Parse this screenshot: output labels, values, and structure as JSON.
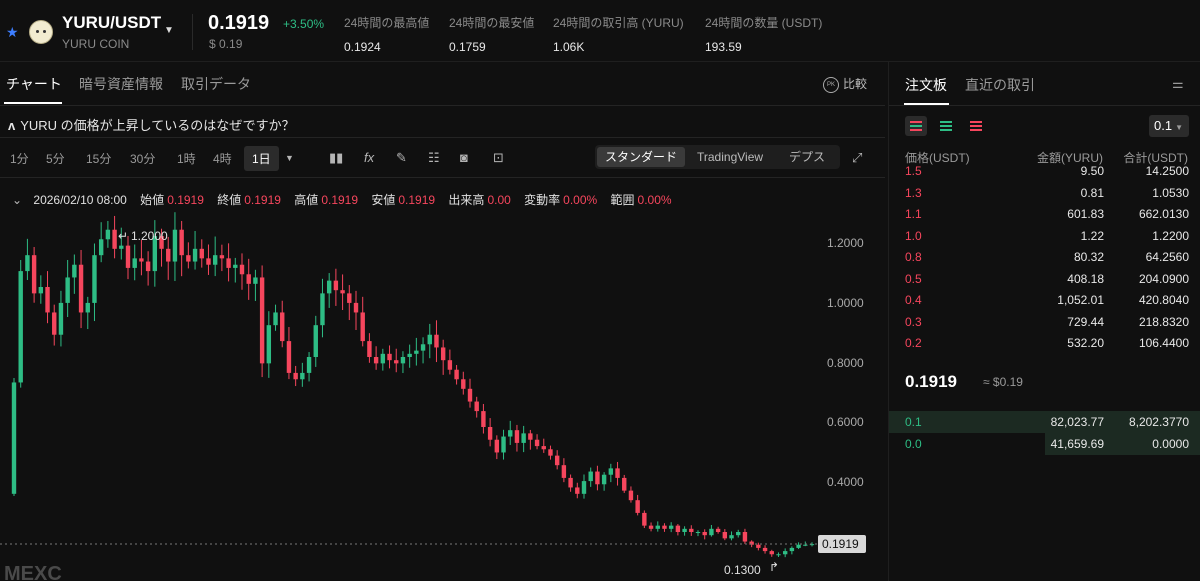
{
  "header": {
    "pair": "YURU/USDT",
    "coin_name": "YURU COIN",
    "price": "0.1919",
    "change": "+3.50%",
    "price_usd": "$ 0.19",
    "stats": [
      {
        "label": "24時間の最高値",
        "value": "0.1924"
      },
      {
        "label": "24時間の最安値",
        "value": "0.1759"
      },
      {
        "label": "24時間の取引高 (YURU)",
        "value": "1.06K"
      },
      {
        "label": "24時間の数量 (USDT)",
        "value": "193.59"
      }
    ]
  },
  "left_tabs": [
    "チャート",
    "暗号資産情報",
    "取引データ"
  ],
  "compare_label": "比較",
  "compare_icon": "PK",
  "why_text": "YURU の価格が上昇しているのはなぜですか？",
  "intervals": [
    "1分",
    "5分",
    "15分",
    "30分",
    "1時",
    "4時",
    "1日"
  ],
  "selected_interval": "1日",
  "view_modes": [
    "スタンダード",
    "TradingView",
    "デプス"
  ],
  "ohlc": {
    "date": "2026/02/10 08:00",
    "open_label": "始値",
    "open": "0.1919",
    "close_label": "終値",
    "close": "0.1919",
    "high_label": "高値",
    "high": "0.1919",
    "low_label": "安値",
    "low": "0.1919",
    "volume_label": "出来高",
    "volume": "0.00",
    "change_label": "変動率",
    "change": "0.00%",
    "range_label": "範囲",
    "range": "0.00%"
  },
  "chart_data": {
    "type": "candlestick",
    "y_ticks": [
      1.2,
      1.0,
      0.8,
      0.6,
      0.4
    ],
    "y_tick_labels": [
      "1.2000",
      "1.0000",
      "0.8000",
      "0.6000",
      "0.4000"
    ],
    "ylim": [
      0.12,
      1.33
    ],
    "high_marker": "1.2000",
    "low_marker": "0.1300",
    "last_price": "0.1919",
    "watermark": "MEXC",
    "colors": {
      "up": "#2ebd85",
      "down": "#f6465d"
    },
    "closes": [
      0.7,
      1.05,
      1.1,
      0.98,
      1.0,
      0.92,
      0.85,
      0.95,
      1.03,
      1.07,
      0.92,
      0.95,
      1.1,
      1.15,
      1.18,
      1.12,
      1.13,
      1.06,
      1.09,
      1.08,
      1.05,
      1.16,
      1.12,
      1.08,
      1.18,
      1.1,
      1.08,
      1.12,
      1.09,
      1.07,
      1.1,
      1.09,
      1.06,
      1.07,
      1.04,
      1.01,
      1.03,
      0.76,
      0.88,
      0.92,
      0.83,
      0.73,
      0.71,
      0.73,
      0.78,
      0.88,
      0.98,
      1.02,
      0.99,
      0.98,
      0.95,
      0.92,
      0.83,
      0.78,
      0.76,
      0.79,
      0.77,
      0.76,
      0.78,
      0.79,
      0.8,
      0.82,
      0.85,
      0.81,
      0.77,
      0.74,
      0.71,
      0.68,
      0.64,
      0.61,
      0.56,
      0.52,
      0.48,
      0.53,
      0.55,
      0.51,
      0.54,
      0.52,
      0.5,
      0.49,
      0.47,
      0.44,
      0.4,
      0.37,
      0.35,
      0.39,
      0.42,
      0.38,
      0.41,
      0.43,
      0.4,
      0.36,
      0.33,
      0.29,
      0.25,
      0.24,
      0.25,
      0.24,
      0.25,
      0.23,
      0.24,
      0.23,
      0.23,
      0.22,
      0.24,
      0.23,
      0.21,
      0.22,
      0.23,
      0.2,
      0.19,
      0.18,
      0.17,
      0.16,
      0.16,
      0.17,
      0.18,
      0.19,
      0.19,
      0.1919
    ]
  },
  "right_tabs": [
    "注文板",
    "直近の取引"
  ],
  "precision": "0.1",
  "orderbook_headers": [
    "価格(USDT)",
    "金額(YURU)",
    "合計(USDT)"
  ],
  "asks": [
    {
      "price": "1.5",
      "amount": "9.50",
      "total": "14.2500"
    },
    {
      "price": "1.3",
      "amount": "0.81",
      "total": "1.0530"
    },
    {
      "price": "1.1",
      "amount": "601.83",
      "total": "662.0130"
    },
    {
      "price": "1.0",
      "amount": "1.22",
      "total": "1.2200"
    },
    {
      "price": "0.8",
      "amount": "80.32",
      "total": "64.2560"
    },
    {
      "price": "0.5",
      "amount": "408.18",
      "total": "204.0900"
    },
    {
      "price": "0.4",
      "amount": "1,052.01",
      "total": "420.8040"
    },
    {
      "price": "0.3",
      "amount": "729.44",
      "total": "218.8320"
    },
    {
      "price": "0.2",
      "amount": "532.20",
      "total": "106.4400"
    }
  ],
  "mid_price": "0.1919",
  "mid_usd": "≈ $0.19",
  "bids": [
    {
      "price": "0.1",
      "amount": "82,023.77",
      "total": "8,202.3770"
    },
    {
      "price": "0.0",
      "amount": "41,659.69",
      "total": "0.0000"
    }
  ]
}
